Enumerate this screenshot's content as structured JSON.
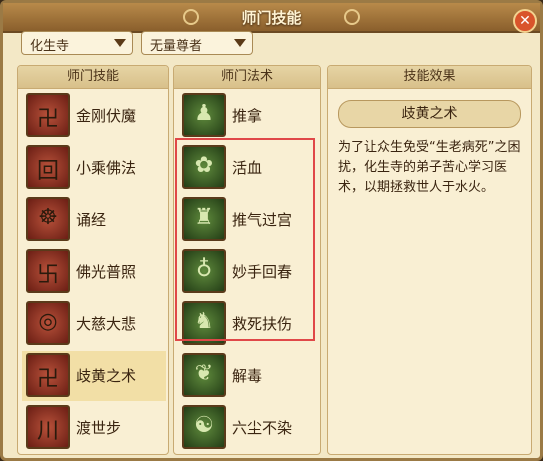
{
  "window": {
    "title": "师门技能",
    "close_label": "✕"
  },
  "filters": {
    "school": "化生寺",
    "master": "无量尊者"
  },
  "skills_panel": {
    "header": "师门技能",
    "items": [
      {
        "label": "金刚伏魔",
        "icon": "vajra-icon"
      },
      {
        "label": "小乘佛法",
        "icon": "dharma-icon"
      },
      {
        "label": "诵经",
        "icon": "sutra-icon"
      },
      {
        "label": "佛光普照",
        "icon": "buddha-light-icon"
      },
      {
        "label": "大慈大悲",
        "icon": "compassion-icon"
      },
      {
        "label": "歧黄之术",
        "icon": "medicine-icon"
      },
      {
        "label": "渡世步",
        "icon": "step-icon"
      }
    ]
  },
  "spells_panel": {
    "header": "师门法术",
    "items": [
      {
        "label": "推拿",
        "icon": "massage-icon"
      },
      {
        "label": "活血",
        "icon": "blood-icon"
      },
      {
        "label": "推气过宫",
        "icon": "qi-icon"
      },
      {
        "label": "妙手回春",
        "icon": "gourd-icon"
      },
      {
        "label": "救死扶伤",
        "icon": "rescue-icon"
      },
      {
        "label": "解毒",
        "icon": "herb-icon"
      },
      {
        "label": "六尘不染",
        "icon": "monk-icon"
      }
    ]
  },
  "effect_panel": {
    "header": "技能效果",
    "title": "歧黄之术",
    "description": "为了让众生免受“生老病死”之困扰，化生寺的弟子苦心学习医术，以期拯救世人于水火。"
  },
  "colors": {
    "highlight_border": "#e04848",
    "title_bar": "#8a5f2c"
  }
}
